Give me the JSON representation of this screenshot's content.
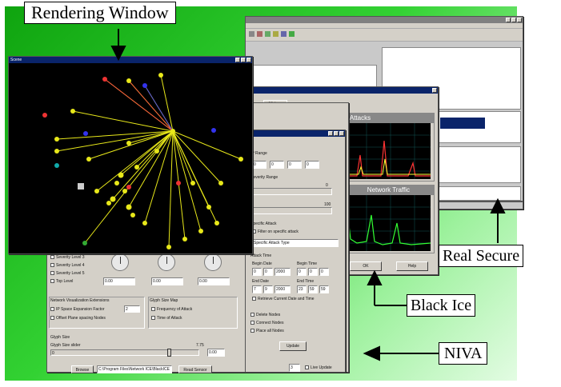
{
  "annotations": {
    "rendering_window": "Rendering Window",
    "real_secure": "Real Secure",
    "black_ice": "Black Ice",
    "niva": "NIVA"
  },
  "scene": {
    "title": "Scene"
  },
  "black_ice": {
    "tab_label": "History",
    "panel_attacks": "Attacks",
    "panel_traffic": "Network Traffic",
    "ok": "OK",
    "help": "Help"
  },
  "filter": {
    "ip_range_label": "IP Range",
    "ip_octets": [
      "0",
      "0",
      "0",
      "0"
    ],
    "severity_range_label": "Severity Range",
    "severity_low": "0",
    "severity_high": "100",
    "specific_attack_label": "Specific Attack",
    "filter_on_attack": "Filter on specific attack",
    "attack_value": "Specific Attack Type",
    "attack_time_label": "Attack Time",
    "begin_date_label": "Begin Date",
    "begin_time_label": "Begin Time",
    "begin_date": [
      "0",
      "0",
      "2000"
    ],
    "begin_time": [
      "0",
      "0",
      "0"
    ],
    "end_date_label": "End Date",
    "end_time_label": "End Time",
    "end_date": [
      "7",
      "9",
      "2000"
    ],
    "end_time": [
      "23",
      "59",
      "59"
    ],
    "retrieve_current": "Retrieve Current Date and Time",
    "delete_nodes": "Delete Nodes",
    "connect_nodes": "Connect Nodes",
    "place_all_nodes": "Place all Nodes",
    "update": "Update",
    "page_value": "3",
    "live_update": "Live Update"
  },
  "niva": {
    "severity_items": [
      "Severity Level 3",
      "Severity Level 4",
      "Severity Level 5",
      "Top Level"
    ],
    "knob_values": [
      "0.00",
      "0.00",
      "0.00"
    ],
    "nvx_title": "Network Visualization Extensions",
    "ip_space_label": "IP Space Expansion Factor",
    "ip_space_value": "2",
    "offset_label": "Offset Plane spacing Nodes",
    "glyph_title": "Glyph Size Map",
    "freq_attack": "Frequency of Attack",
    "time_attack": "Time of Attack",
    "glyph_size": "Glyph Size",
    "glyph_slider_label": "Glyph Size slider",
    "glyph_slider_value": "7.75",
    "glyph_slider_min": "0",
    "glyph_field": "0.00",
    "browse": "Browse",
    "path": "C:\\Program Files\\Network ICE\\BlackICE",
    "read_sensor": "Read Sensor"
  }
}
